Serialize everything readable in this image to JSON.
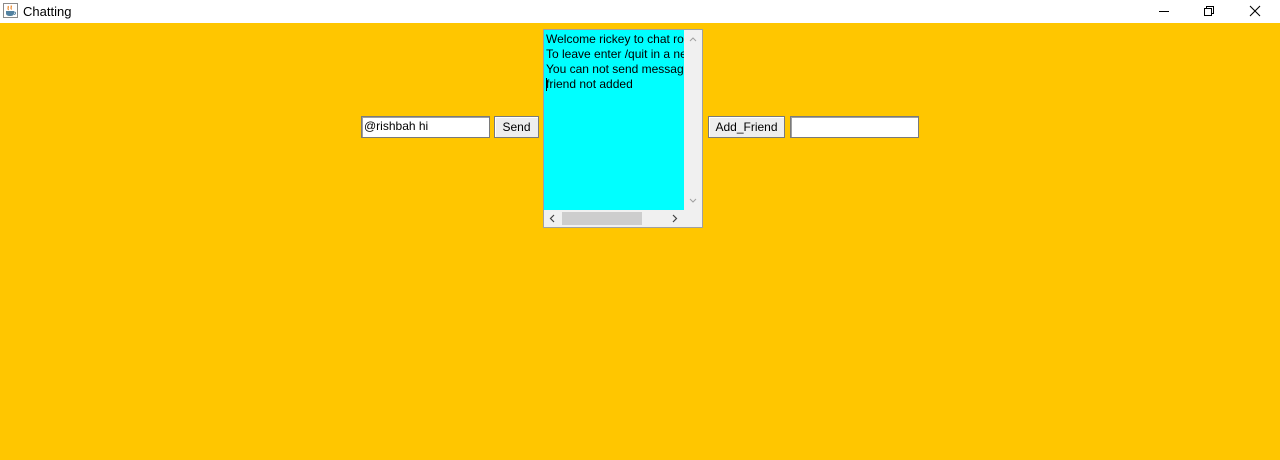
{
  "window": {
    "title": "Chatting",
    "background_color": "#ffc600",
    "app_icon": "java-cup-icon"
  },
  "titlebar_buttons": {
    "minimize": "minimize-icon",
    "maximize": "restore-icon",
    "close": "close-icon"
  },
  "chat": {
    "message_input_value": "@rishbah hi",
    "send_label": "Send",
    "add_friend_label": "Add_Friend",
    "friend_input_value": "",
    "chat_area_color": "#00ffff",
    "lines": [
      "Welcome rickey to chat room",
      "To leave enter /quit in a new line",
      "You can not send message",
      "friend not added"
    ]
  }
}
